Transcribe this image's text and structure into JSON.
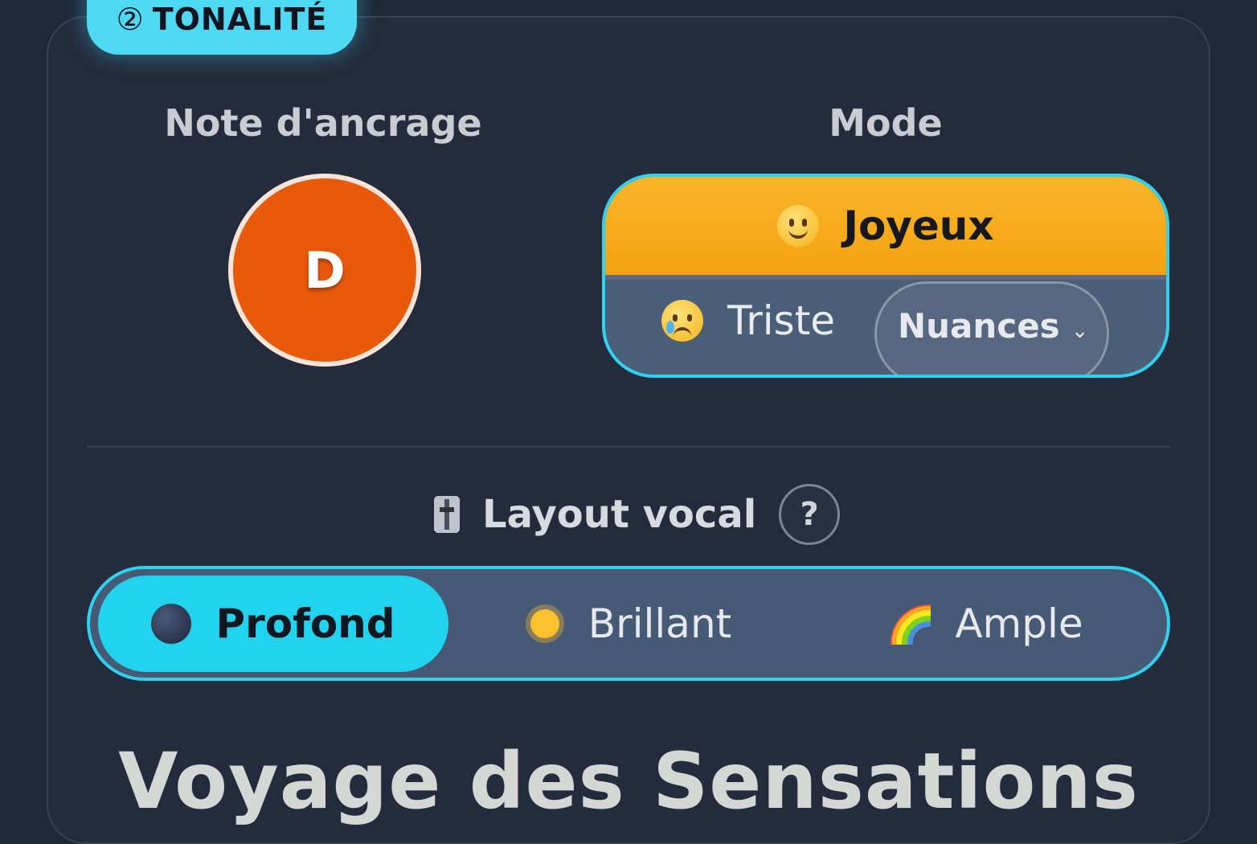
{
  "section": {
    "number": "②",
    "title": "TONALITÉ"
  },
  "anchor_note": {
    "label": "Note d'ancrage",
    "value": "D"
  },
  "mode": {
    "label": "Mode",
    "selected": {
      "icon": "smiling-face-icon",
      "label": "Joyeux"
    },
    "other": {
      "icon": "crying-face-icon",
      "label": "Triste"
    },
    "nuances_label": "Nuances",
    "nuances_chevron": "⌄"
  },
  "layout_vocal": {
    "icon": "mixer-slider-icon",
    "title": "Layout vocal",
    "help_label": "?",
    "options": [
      {
        "icon": "moon-icon",
        "label": "Profond",
        "active": true
      },
      {
        "icon": "sun-icon",
        "label": "Brillant",
        "active": false
      },
      {
        "icon": "rainbow-icon",
        "label": "Ample",
        "active": false
      }
    ]
  },
  "journey": {
    "title": "Voyage des Sensations"
  },
  "colors": {
    "accent": "#22d3ee",
    "note_circle": "#e8590c",
    "mode_selected": "#f5a623",
    "background": "#1f2838"
  }
}
